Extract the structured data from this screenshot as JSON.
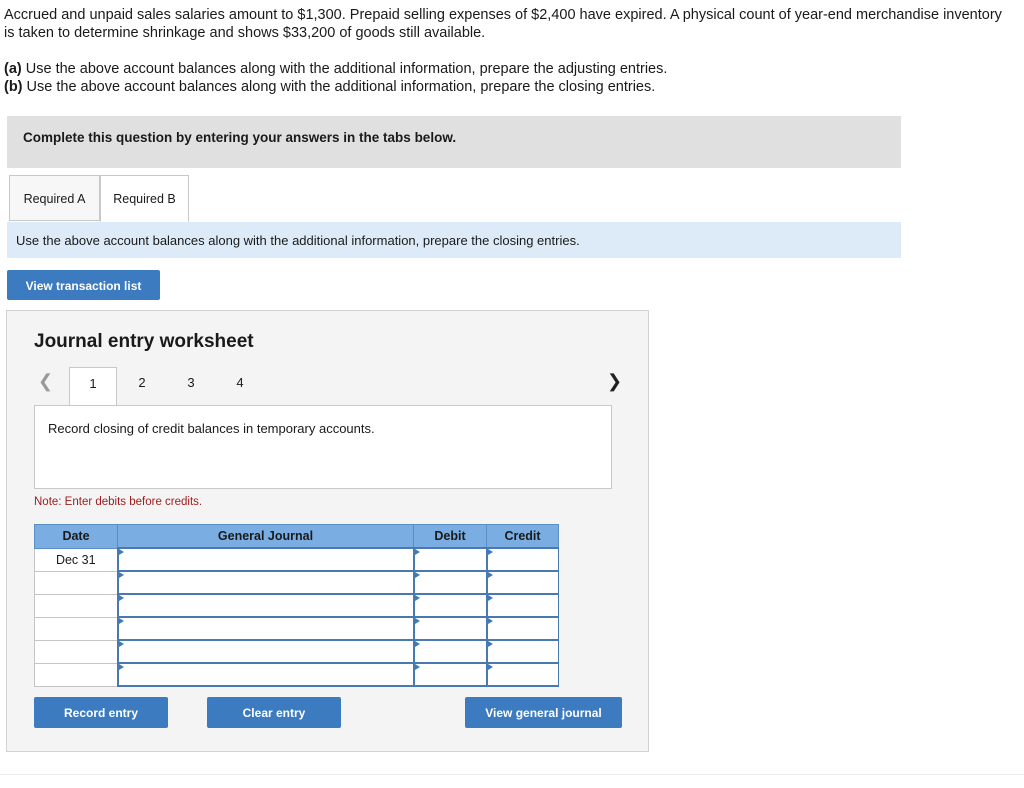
{
  "intro": {
    "text": "Accrued and unpaid sales salaries amount to $1,300. Prepaid selling expenses of $2,400 have expired. A physical count of year-end merchandise inventory is taken to determine shrinkage and shows $33,200 of goods still available."
  },
  "parts": {
    "a_label": "(a)",
    "a_text": " Use the above account balances along with the additional information, prepare the adjusting entries.",
    "b_label": "(b)",
    "b_text": " Use the above account balances along with the additional information, prepare the closing entries."
  },
  "banner": "Complete this question by entering your answers in the tabs below.",
  "tabs": [
    {
      "label": "Required A",
      "active": false
    },
    {
      "label": "Required B",
      "active": true
    }
  ],
  "instruction": "Use the above account balances along with the additional information, prepare the closing entries.",
  "view_transaction_list": "View transaction list",
  "worksheet": {
    "title": "Journal entry worksheet",
    "prev_icon": "chevron-left-icon",
    "next_icon": "chevron-right-icon",
    "pages": [
      "1",
      "2",
      "3",
      "4"
    ],
    "active_page": "1",
    "description": "Record closing of credit balances in temporary accounts.",
    "note": "Note: Enter debits before credits.",
    "table": {
      "headers": [
        "Date",
        "General Journal",
        "Debit",
        "Credit"
      ],
      "rows": [
        {
          "date": "Dec 31",
          "account": "",
          "debit": "",
          "credit": ""
        },
        {
          "date": "",
          "account": "",
          "debit": "",
          "credit": ""
        },
        {
          "date": "",
          "account": "",
          "debit": "",
          "credit": ""
        },
        {
          "date": "",
          "account": "",
          "debit": "",
          "credit": ""
        },
        {
          "date": "",
          "account": "",
          "debit": "",
          "credit": ""
        },
        {
          "date": "",
          "account": "",
          "debit": "",
          "credit": ""
        }
      ]
    },
    "buttons": {
      "record": "Record entry",
      "clear": "Clear entry",
      "view_general_journal": "View general journal"
    }
  },
  "colors": {
    "button_blue": "#3c7bc0",
    "header_blue": "#7aaee3",
    "instruction_bg": "#dcebf7",
    "note_red": "#9b1c1c"
  }
}
